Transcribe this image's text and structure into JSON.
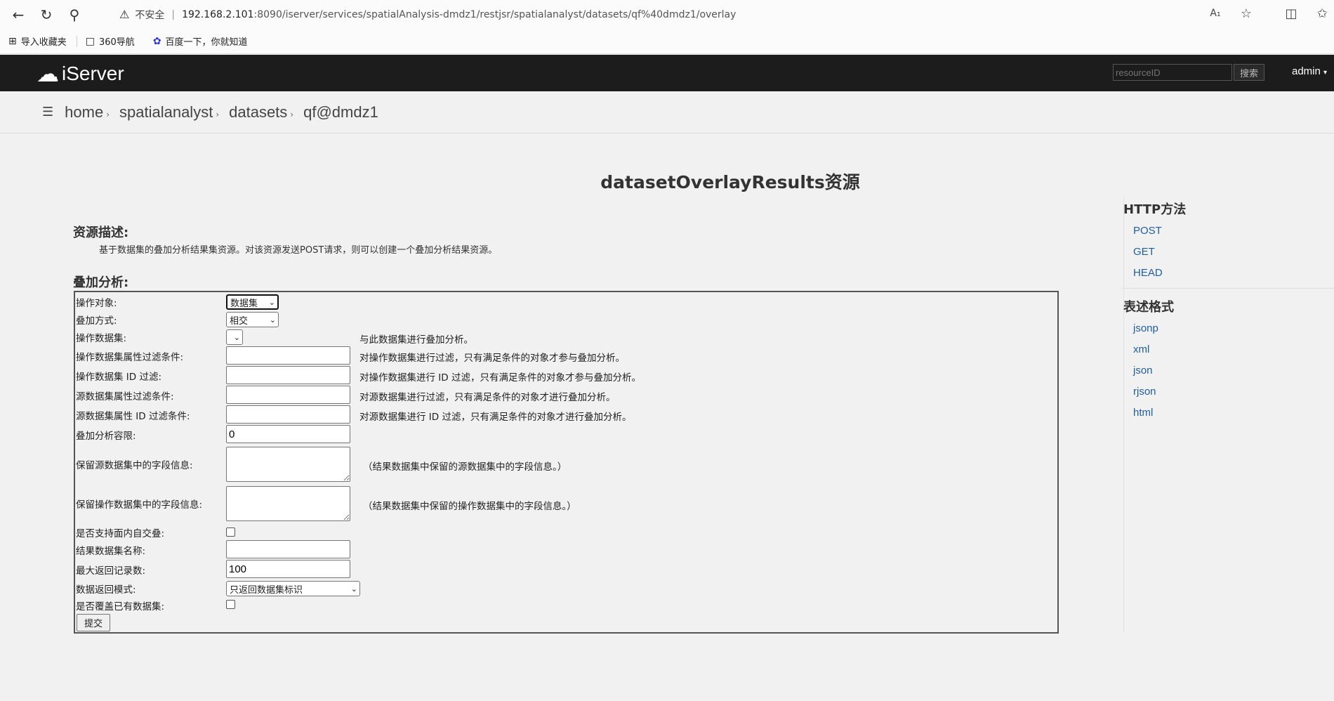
{
  "browser": {
    "insecure_label": "不安全",
    "url_host": "192.168.2.101",
    "url_path": ":8090/iserver/services/spatialAnalysis-dmdz1/restjsr/spatialanalyst/datasets/qf%40dmdz1/overlay",
    "bookmarks": [
      "导入收藏夹",
      "360导航",
      "百度一下，你就知道"
    ]
  },
  "header": {
    "brand": "iServer",
    "search_placeholder": "resourceID",
    "search_button": "搜索",
    "user": "admin"
  },
  "breadcrumb": [
    "home",
    "spatialanalyst",
    "datasets",
    "qf@dmdz1"
  ],
  "page": {
    "title": "datasetOverlayResults资源",
    "desc_title": "资源描述:",
    "desc_text": "基于数据集的叠加分析结果集资源。对该资源发送POST请求，则可以创建一个叠加分析结果资源。",
    "form_title": "叠加分析:"
  },
  "form": {
    "operate_target_label": "操作对象:",
    "operate_target_value": "数据集",
    "overlay_mode_label": "叠加方式:",
    "overlay_mode_value": "相交",
    "operate_dataset_label": "操作数据集:",
    "operate_dataset_hint": "与此数据集进行叠加分析。",
    "op_attr_filter_label": "操作数据集属性过滤条件:",
    "op_attr_filter_hint": "对操作数据集进行过滤，只有满足条件的对象才参与叠加分析。",
    "op_id_filter_label": "操作数据集 ID 过滤:",
    "op_id_filter_hint": "对操作数据集进行 ID 过滤，只有满足条件的对象才参与叠加分析。",
    "src_attr_filter_label": "源数据集属性过滤条件:",
    "src_attr_filter_hint": "对源数据集进行过滤，只有满足条件的对象才进行叠加分析。",
    "src_id_filter_label": "源数据集属性 ID 过滤条件:",
    "src_id_filter_hint": "对源数据集进行 ID 过滤，只有满足条件的对象才进行叠加分析。",
    "tolerance_label": "叠加分析容限:",
    "tolerance_value": "0",
    "src_fields_label": "保留源数据集中的字段信息:",
    "src_fields_hint": "（结果数据集中保留的源数据集中的字段信息。）",
    "op_fields_label": "保留操作数据集中的字段信息:",
    "op_fields_hint": "（结果数据集中保留的操作数据集中的字段信息。）",
    "self_intersect_label": "是否支持面内自交叠:",
    "result_name_label": "结果数据集名称:",
    "max_records_label": "最大返回记录数:",
    "max_records_value": "100",
    "return_mode_label": "数据返回模式:",
    "return_mode_value": "只返回数据集标识",
    "overwrite_label": "是否覆盖已有数据集:",
    "submit": "提交"
  },
  "sidebar": {
    "methods_title": "HTTP方法",
    "methods": [
      "POST",
      "GET",
      "HEAD"
    ],
    "formats_title": "表述格式",
    "formats": [
      "jsonp",
      "xml",
      "json",
      "rjson",
      "html"
    ]
  }
}
